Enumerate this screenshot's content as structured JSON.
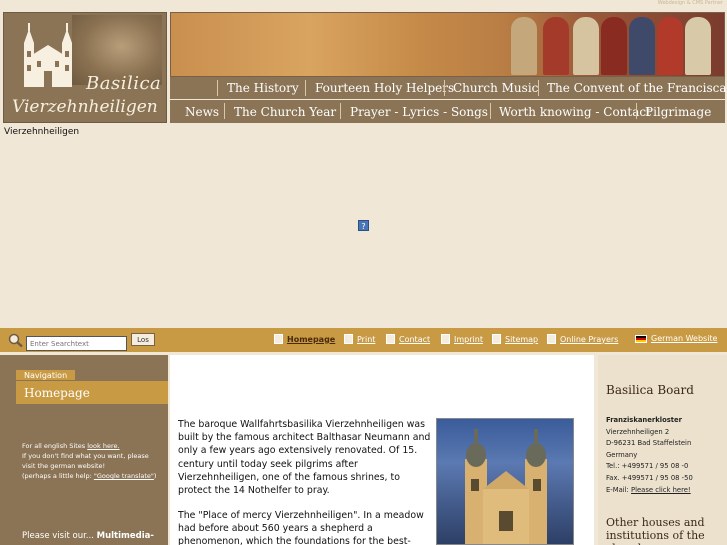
{
  "top_strip": {
    "credit": "Webdesign & CMS Partner"
  },
  "logo": {
    "line1": "Basilica",
    "line2": "Vierzehnheiligen"
  },
  "nav_top": [
    "The History",
    "Fourteen Holy Helpers",
    "Church Music",
    "The Convent of the Franciscans"
  ],
  "nav_bottom": [
    "News",
    "The Church Year",
    "Prayer - Lyrics - Songs",
    "Worth knowing - Contact",
    "Pilgrimage"
  ],
  "breadcrumb": "Vierzehnheiligen",
  "flash_placeholder": "?",
  "search": {
    "placeholder": "Enter Searchtext",
    "button": "Los"
  },
  "toolbar_links": {
    "homepage": "Homepage",
    "print": "Print",
    "contact": "Contact",
    "imprint": "Imprint",
    "sitemap": "Sitemap",
    "online_prayers": "Online Prayers",
    "german": "German Website"
  },
  "left": {
    "nav_label": "Navigation",
    "nav_home": "Homepage",
    "eng_l1a": "For all english Sites ",
    "eng_link": "look here.",
    "eng_l2": "If you don't find what you want, please",
    "eng_l3": "visit the german website!",
    "eng_l4a": "(perhaps a little help: ",
    "eng_link2": "\"Google translate\"",
    "eng_l4b": ")",
    "visit_a": "Please visit our... ",
    "visit_b": "Multimedia-"
  },
  "main": {
    "p1": "The baroque Wallfahrtsbasilika Vierzehnheiligen was built by the famous architect Balthasar Neumann and only a few years ago extensively renovated. Of 15. century until today seek pilgrims after Vierzehnheiligen, one of the famous shrines, to protect the 14 Nothelfer to pray.",
    "p2": "The \"Place of mercy Vierzehnheiligen\". In a meadow had before about 560 years a shepherd a phenomenon, which the foundations for the best-known Wallfahrtskirchen"
  },
  "right": {
    "board_title": "Basilica Board",
    "addr_title": "Franziskanerkloster",
    "addr_l1": "Vierzehnheiligen 2",
    "addr_l2": "D-96231 Bad Staffelstein",
    "addr_l3": "Germany",
    "tel": "Tel.: +499571 / 95 08 -0",
    "fax": "Fax. +499571 / 95 08 -50",
    "email_label": "E-Mail: ",
    "email_link": "Please click here!",
    "other": "Other houses and institutions of the church"
  },
  "colors": {
    "bar_brown": "#8b7455",
    "bar_gold": "#c99a44",
    "page_bg": "#f1e7d6"
  }
}
